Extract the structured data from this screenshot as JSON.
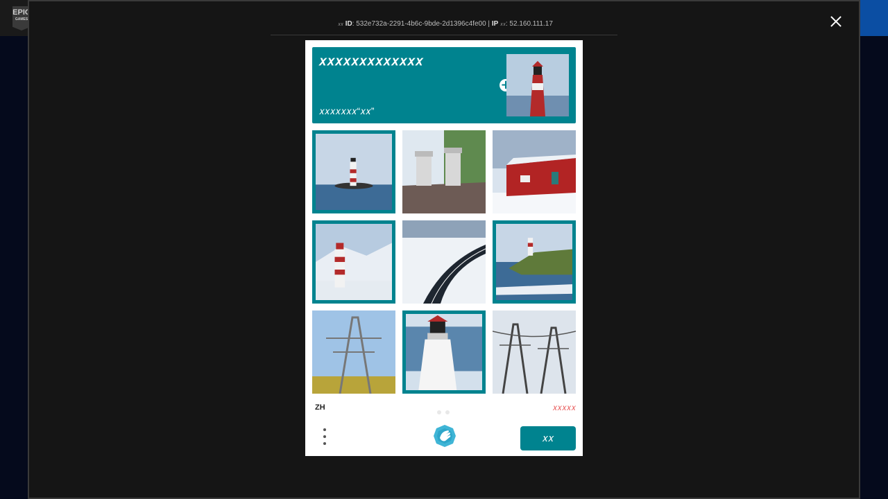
{
  "background_page": {
    "logo_text": "EPIC",
    "logo_subtext": "GAMES"
  },
  "modal": {
    "info": {
      "id_prefix": "𝑥𝑥",
      "id_label": "ID",
      "id_value": "532e732a-2291-4b6c-9bde-2d1396c4fe00",
      "separator": "|",
      "ip_label": "IP",
      "ip_prefix": "𝑥𝑥",
      "ip_value": "52.160.111.17"
    }
  },
  "captcha": {
    "prompt_title": "𝑥𝑥𝑥𝑥𝑥𝑥𝑥𝑥𝑥𝑥𝑥𝑥𝑥",
    "prompt_subtitle": "𝑥𝑥𝑥𝑥𝑥𝑥𝑥“𝑥𝑥”",
    "prompt_image": "lighthouse",
    "tiles": [
      {
        "subject": "lighthouse-on-island",
        "selected": true
      },
      {
        "subject": "chimneys-on-roof",
        "selected": false
      },
      {
        "subject": "red-barn-in-snow",
        "selected": false
      },
      {
        "subject": "lighthouse-snowy-mountains",
        "selected": true
      },
      {
        "subject": "snowy-highway",
        "selected": false
      },
      {
        "subject": "lighthouse-on-green-cliff",
        "selected": true
      },
      {
        "subject": "power-pylon-yellow",
        "selected": false
      },
      {
        "subject": "lighthouse-closeup",
        "selected": true
      },
      {
        "subject": "power-pylons-grey",
        "selected": false
      }
    ],
    "language": "ZH",
    "report_label": "𝑥𝑥𝑥𝑥𝑥",
    "next_label": "𝑥𝑥",
    "colors": {
      "accent": "#00838f",
      "report": "#e85a5a"
    }
  }
}
